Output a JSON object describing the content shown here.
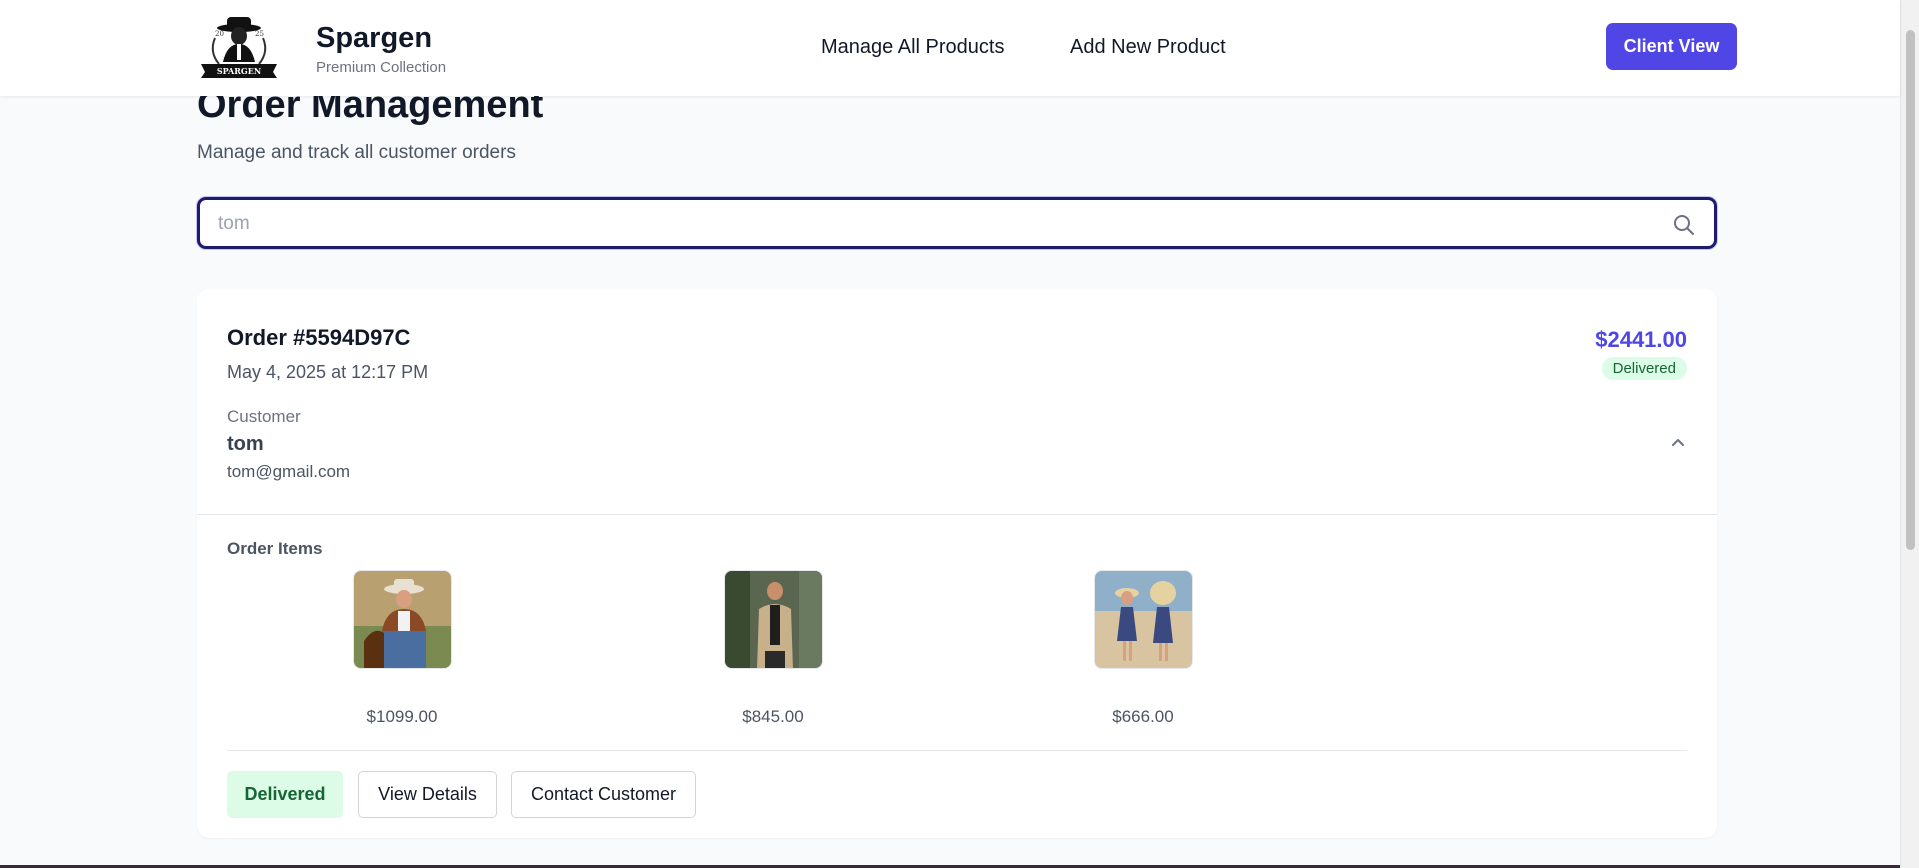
{
  "header": {
    "brand_name": "Spargen",
    "brand_sub": "Premium Collection",
    "logo_text": "SPARGEN",
    "nav": [
      "Manage All Products",
      "Add New Product"
    ],
    "client_view": "Client View"
  },
  "page": {
    "title": "Order Management",
    "subtitle": "Manage and track all customer orders"
  },
  "search": {
    "value": "tom",
    "icon": "search-icon"
  },
  "order": {
    "id": "Order #5594D97C",
    "date": "May 4, 2025 at 12:17 PM",
    "total": "$2441.00",
    "status": "Delivered",
    "customer_label": "Customer",
    "customer_name": "tom",
    "customer_email": "tom@gmail.com",
    "items_label": "Order Items",
    "items": [
      {
        "price": "$1099.00",
        "image": "cowboy-outfit-photo"
      },
      {
        "price": "$845.00",
        "image": "trench-coat-photo"
      },
      {
        "price": "$666.00",
        "image": "kids-beach-dresses-photo"
      }
    ],
    "actions": {
      "delivered": "Delivered",
      "view_details": "View Details",
      "contact_customer": "Contact Customer"
    }
  },
  "colors": {
    "accent": "#4f46e5",
    "success_bg": "#dcfce7",
    "success_text": "#166534",
    "search_border": "#1e1b6b"
  }
}
